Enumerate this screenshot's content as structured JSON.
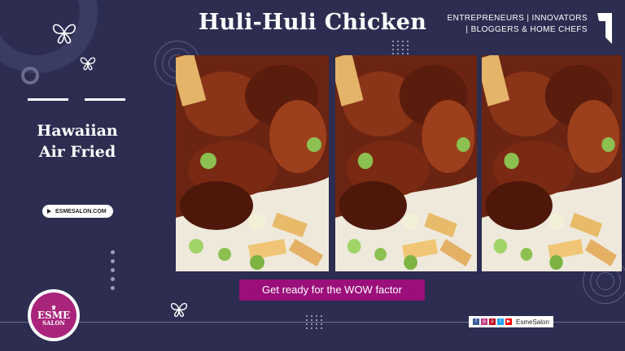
{
  "header": {
    "title": "Huli-Huli Chicken"
  },
  "tagline": {
    "line1": "ENTREPRENEURS | INNOVATORS",
    "line2": "| BLOGGERS & HOME CHEFS"
  },
  "side": {
    "line1": "Hawaiian",
    "line2": "Air Fried"
  },
  "site_pill": {
    "label": "ESMESALON.COM"
  },
  "cta": {
    "label": "Get ready for the WOW factor"
  },
  "social": {
    "handle": "EsmeSalon",
    "icons": [
      "facebook-icon",
      "instagram-icon",
      "pinterest-icon",
      "twitter-icon",
      "youtube-icon"
    ]
  },
  "logo": {
    "word1": "ESME",
    "word2": "SALON"
  },
  "colors": {
    "background": "#2c2d50",
    "accent": "#9b0f7b",
    "logo": "#a9247b"
  }
}
